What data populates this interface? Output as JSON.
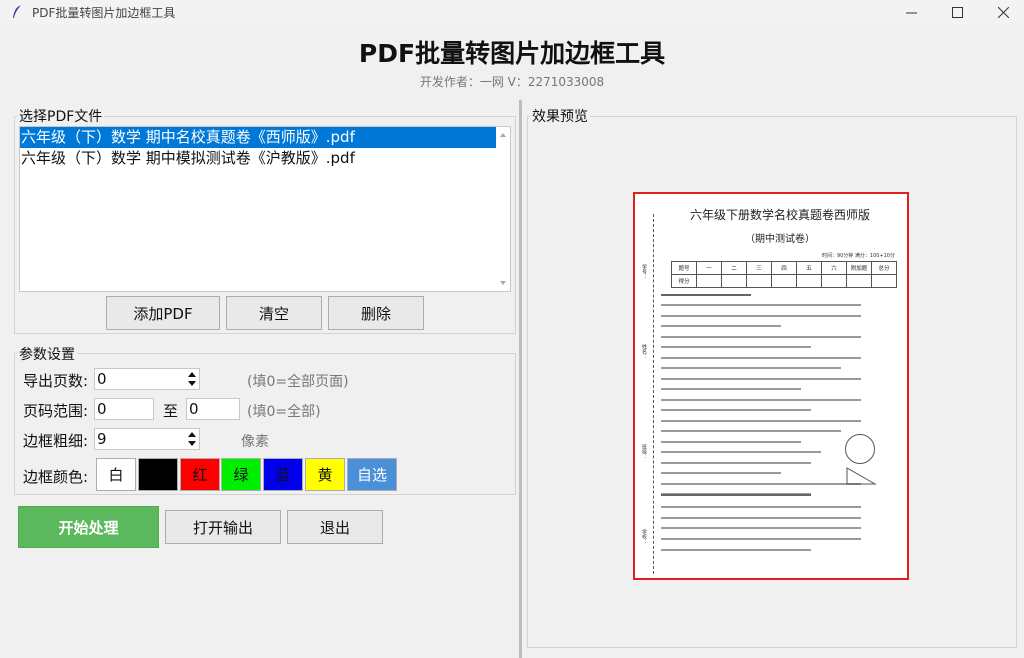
{
  "window": {
    "title": "PDF批量转图片加边框工具"
  },
  "header": {
    "title": "PDF批量转图片加边框工具",
    "author": "开发作者：一网 V：2271033008"
  },
  "file_section": {
    "legend": "选择PDF文件",
    "files": [
      "六年级（下）数学 期中名校真题卷《西师版》.pdf",
      "六年级（下）数学 期中模拟测试卷《沪教版》.pdf"
    ],
    "selected_index": 0,
    "add_label": "添加PDF",
    "clear_label": "清空",
    "delete_label": "删除"
  },
  "params": {
    "legend": "参数设置",
    "export_pages_label": "导出页数:",
    "export_pages_value": "0",
    "export_pages_hint": "(填0=全部页面)",
    "range_label": "页码范围:",
    "range_from": "0",
    "range_sep": "至",
    "range_to": "0",
    "range_hint": "(填0=全部)",
    "border_width_label": "边框粗细:",
    "border_width_value": "9",
    "border_width_unit": "像素",
    "border_color_label": "边框颜色:",
    "colors": [
      {
        "label": "白",
        "bg": "#ffffff",
        "fg": "#111111"
      },
      {
        "label": "",
        "bg": "#000000",
        "fg": "#ffffff"
      },
      {
        "label": "红",
        "bg": "#ff0000",
        "fg": "#111111"
      },
      {
        "label": "绿",
        "bg": "#00ee00",
        "fg": "#111111"
      },
      {
        "label": "蓝",
        "bg": "#0000ee",
        "fg": "#111111"
      },
      {
        "label": "黄",
        "bg": "#ffff00",
        "fg": "#111111"
      }
    ],
    "custom_label": "自选",
    "custom_bg": "#4a90d9"
  },
  "actions": {
    "start_label": "开始处理",
    "start_bg": "#5cb85c",
    "open_label": "打开输出",
    "exit_label": "退出"
  },
  "preview": {
    "legend": "效果预览",
    "border_color": "#e02020",
    "doc_title": "六年级下册数学名校真题卷西师版",
    "doc_subtitle": "（期中测试卷）",
    "doc_time": "时间：90分钟  满分：100+10分",
    "table_header": [
      "题号",
      "一",
      "二",
      "三",
      "四",
      "五",
      "六",
      "附加题",
      "总分"
    ],
    "table_row": [
      "得分",
      "",
      "",
      "",
      "",
      "",
      "",
      "",
      ""
    ],
    "side_labels": [
      "学号：",
      "姓名：",
      "班级：",
      "学校："
    ]
  }
}
